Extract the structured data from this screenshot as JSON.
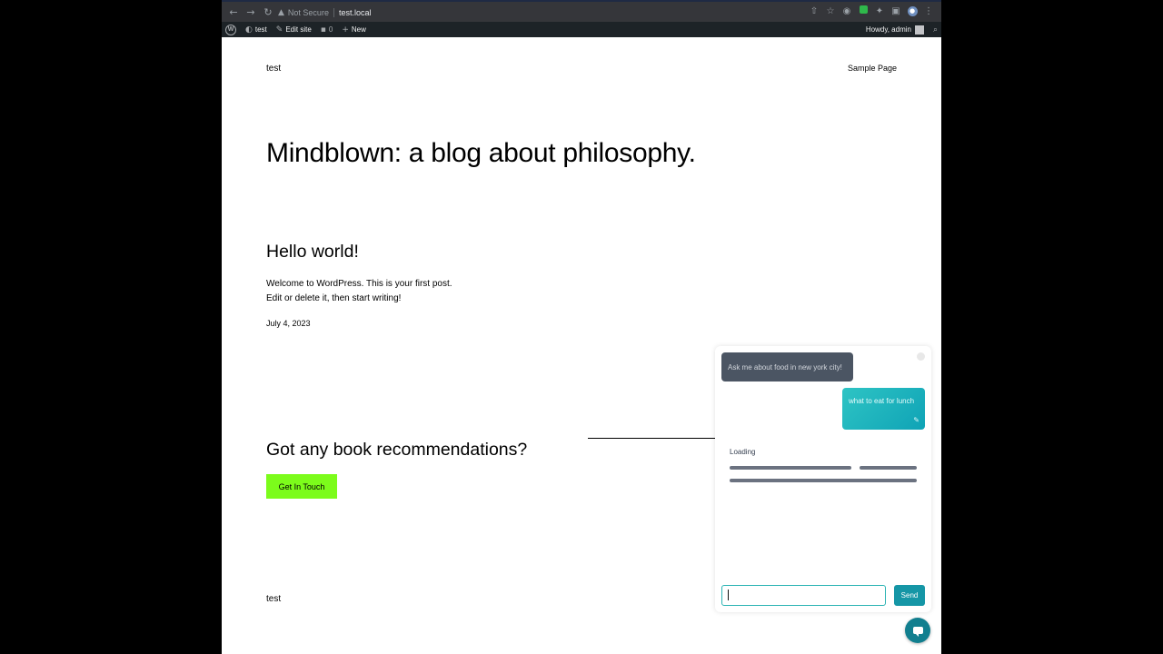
{
  "browser": {
    "security_label": "Not Secure",
    "url": "test.local"
  },
  "adminbar": {
    "site_name": "test",
    "edit_site": "Edit site",
    "comments_count": "0",
    "new_label": "New",
    "howdy": "Howdy, admin"
  },
  "site": {
    "title": "test",
    "nav_item": "Sample Page",
    "hero": "Mindblown: a blog about philosophy.",
    "footer_title": "test"
  },
  "post": {
    "title": "Hello world!",
    "line1": "Welcome to WordPress. This is your first post.",
    "line2": "Edit or delete it, then start writing!",
    "date": "July 4, 2023"
  },
  "cta": {
    "heading": "Got any book recommendations?",
    "button": "Get In Touch",
    "button_color": "#7cfc1b"
  },
  "chat": {
    "bot_message": "Ask me about food in new york city!",
    "user_message": "what to eat for lunch",
    "loading": "Loading",
    "input_value": "",
    "send_label": "Send",
    "accent": "#1596a6"
  }
}
